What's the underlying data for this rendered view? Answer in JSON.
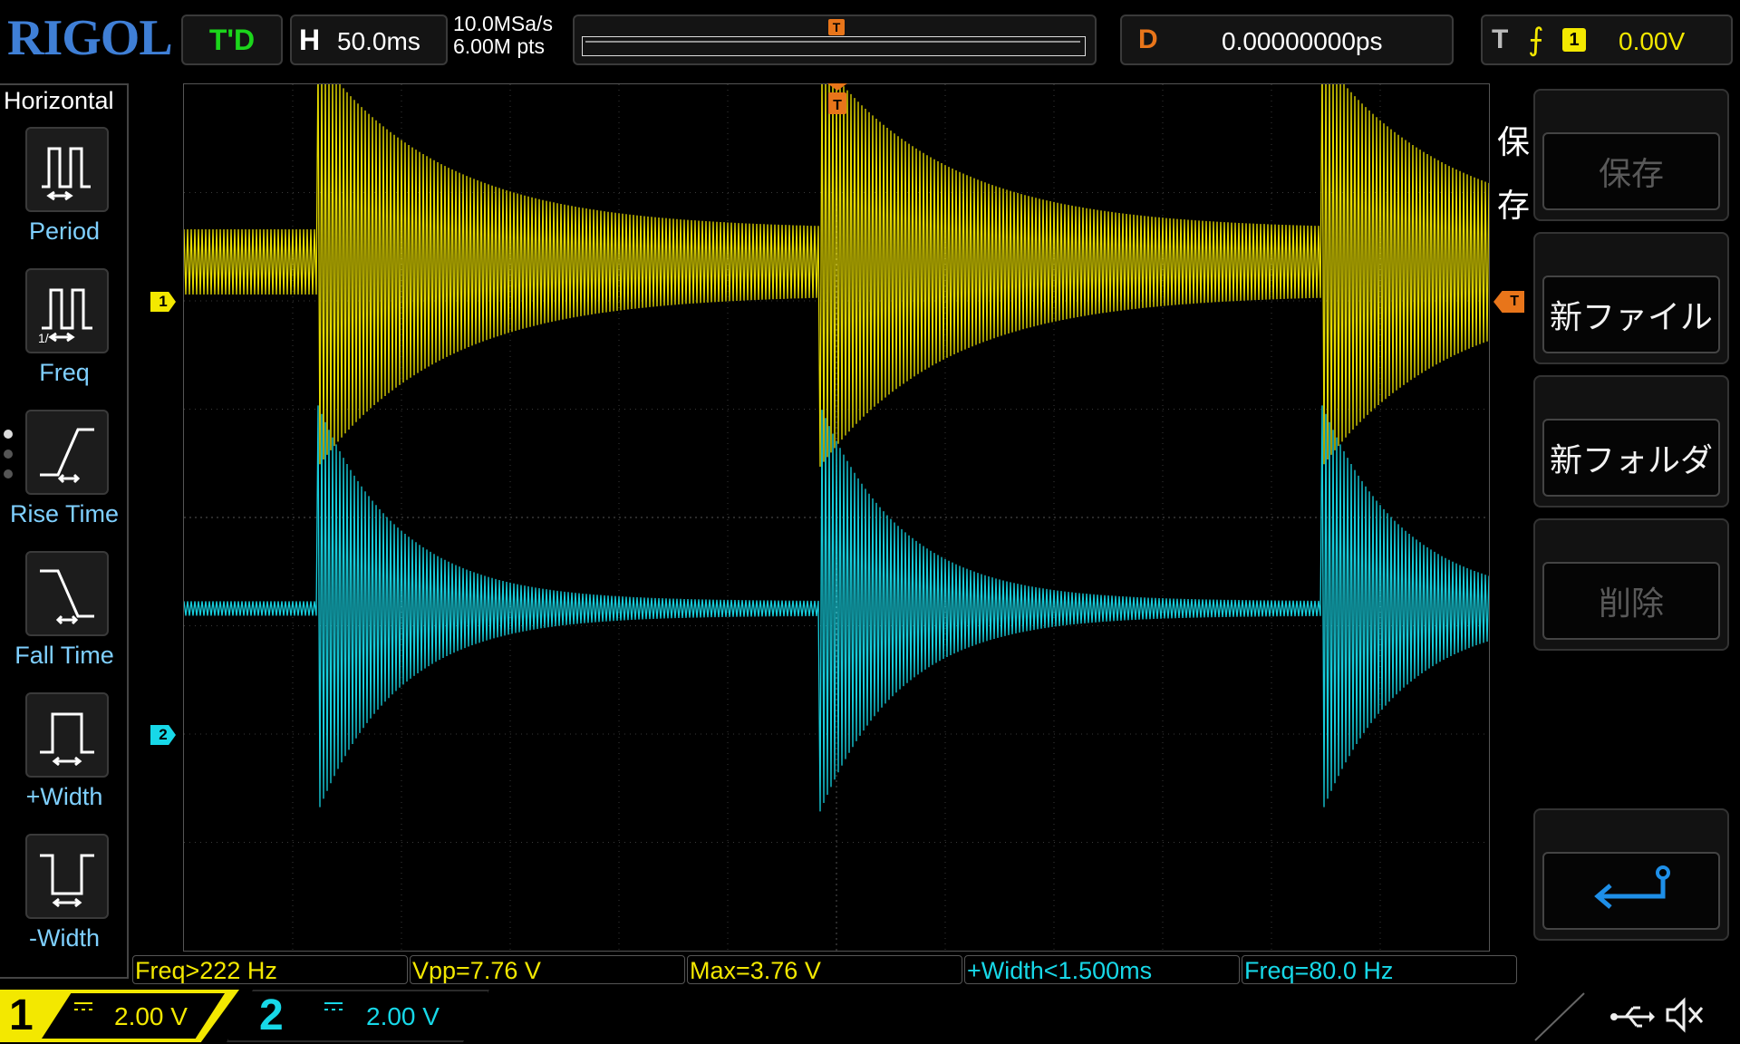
{
  "brand": "RIGOL",
  "status": "T'D",
  "timebase": {
    "label": "H",
    "value": "50.0ms"
  },
  "acquisition": {
    "sample_rate": "10.0MSa/s",
    "memory_depth": "6.00M pts"
  },
  "memory_bar": {
    "trigger_label": "T"
  },
  "delay": {
    "label": "D",
    "value": "0.00000000ps"
  },
  "trigger": {
    "label": "T",
    "edge_icon": "rising-edge-icon",
    "source": "1",
    "level": "0.00V",
    "marker_label": "T"
  },
  "left_menu": {
    "title": "Horizontal",
    "items": [
      {
        "label": "Period",
        "icon": "period-icon"
      },
      {
        "label": "Freq",
        "icon": "freq-icon"
      },
      {
        "label": "Rise Time",
        "icon": "rise-time-icon"
      },
      {
        "label": "Fall Time",
        "icon": "fall-time-icon"
      },
      {
        "label": "+Width",
        "icon": "plus-width-icon"
      },
      {
        "label": "-Width",
        "icon": "minus-width-icon"
      }
    ],
    "page_indicator": {
      "pages": 3,
      "current": 1
    }
  },
  "waveform": {
    "ch1": {
      "marker": "1",
      "color": "#f3e800"
    },
    "ch2": {
      "marker": "2",
      "color": "#17d8e8"
    }
  },
  "right_menu": {
    "title_line1": "保",
    "title_line2": "存",
    "keys": [
      {
        "label": "保存",
        "enabled": false
      },
      {
        "label": "新ファイル",
        "enabled": true
      },
      {
        "label": "新フォルダ",
        "enabled": true
      },
      {
        "label": "削除",
        "enabled": false
      }
    ],
    "back_icon": "return-arrow-icon"
  },
  "measurements": [
    {
      "text": "Freq>222 Hz",
      "channel": 1
    },
    {
      "text": "Vpp=7.76 V",
      "channel": 1
    },
    {
      "text": "Max=3.76 V",
      "channel": 1
    },
    {
      "text": "+Width<1.500ms",
      "channel": 2
    },
    {
      "text": "Freq=80.0 Hz",
      "channel": 2
    }
  ],
  "channels": [
    {
      "number": "1",
      "coupling_icon": "dc-coupling-icon",
      "scale": "2.00 V",
      "color": "#f3e800"
    },
    {
      "number": "2",
      "coupling_icon": "dc-coupling-icon",
      "scale": "2.00 V",
      "color": "#17d8e8"
    }
  ],
  "status_icons": [
    "usb-icon",
    "mute-icon"
  ]
}
